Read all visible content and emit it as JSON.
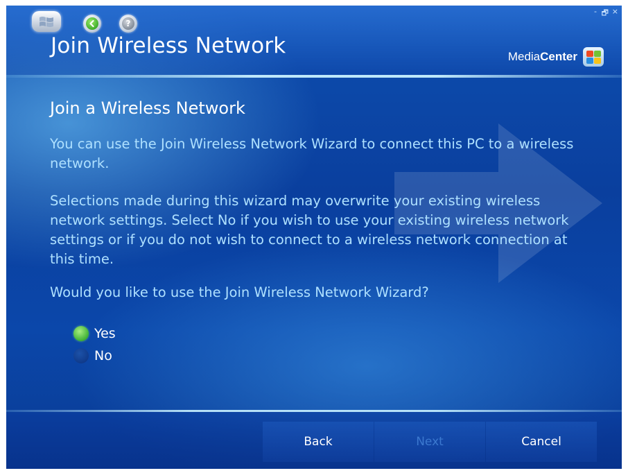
{
  "window": {
    "title": "Join Wireless Network",
    "controls": {
      "minimize": "-",
      "restore": "🗗",
      "close": "×"
    }
  },
  "header": {
    "brand_prefix": "Media",
    "brand_bold": "Center",
    "start_icon": "windows-logo-icon",
    "back_icon": "back-arrow-icon",
    "help_icon": "help-icon",
    "help_glyph": "?"
  },
  "main": {
    "heading": "Join a Wireless Network",
    "paragraph1": "You can use the Join Wireless Network Wizard to connect this PC to a wireless network.",
    "paragraph2": "Selections made during this wizard may overwrite your existing wireless network settings. Select No if you wish to use your existing wireless network settings or if you do not wish to connect to a wireless network connection at this time.",
    "question": "Would you like to use the Join Wireless Network Wizard?",
    "options": [
      {
        "label": "Yes",
        "selected": true
      },
      {
        "label": "No",
        "selected": false
      }
    ]
  },
  "footer": {
    "back_label": "Back",
    "next_label": "Next",
    "next_enabled": false,
    "cancel_label": "Cancel"
  },
  "colors": {
    "background": "#0b47aa",
    "body_text": "#aee0ff",
    "heading_text": "#ffffff",
    "selected_radio": "#46b53a",
    "disabled_button_text": "#3b78cf"
  }
}
